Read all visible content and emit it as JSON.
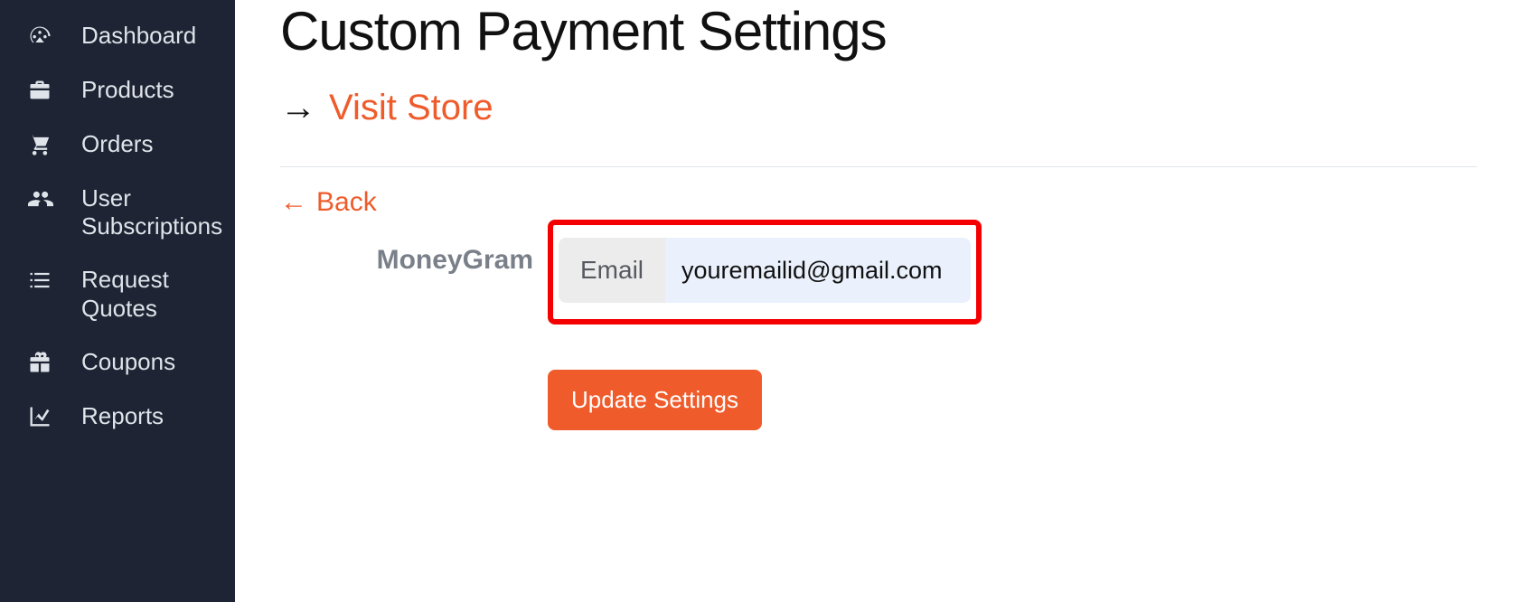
{
  "sidebar": {
    "items": [
      {
        "label": "Dashboard"
      },
      {
        "label": "Products"
      },
      {
        "label": "Orders"
      },
      {
        "label": "User Subscriptions"
      },
      {
        "label": "Request Quotes"
      },
      {
        "label": "Coupons"
      },
      {
        "label": "Reports"
      }
    ]
  },
  "header": {
    "title": "Custom Payment Settings",
    "visit_store": "Visit Store"
  },
  "back": {
    "label": "Back"
  },
  "form": {
    "section_label": "MoneyGram",
    "email_addon": "Email",
    "email_value": "youremailid@gmail.com"
  },
  "actions": {
    "update": "Update Settings"
  }
}
